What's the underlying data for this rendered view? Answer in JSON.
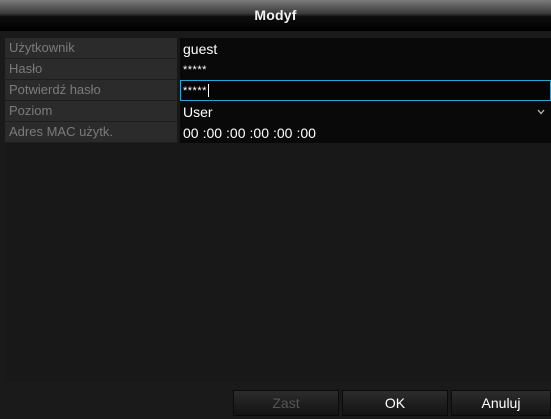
{
  "dialog": {
    "title": "Modyf"
  },
  "fields": {
    "username": {
      "label": "Użytkownik",
      "value": "guest"
    },
    "password": {
      "label": "Hasło",
      "value": "*****"
    },
    "confirm_password": {
      "label": "Potwierdź hasło",
      "value": "*****"
    },
    "level": {
      "label": "Poziom",
      "value": "User",
      "icon": "chevron-down-icon"
    },
    "mac": {
      "label": "Adres MAC użytk.",
      "segments": [
        "00",
        ":00",
        ":00",
        ":00",
        ":00",
        ":00"
      ]
    }
  },
  "buttons": {
    "apply_label": "Zast",
    "ok_label": "OK",
    "cancel_label": "Anuluj"
  },
  "colors": {
    "focus_border": "#28a6d8",
    "label_text": "#7b7b7b",
    "disabled_text": "#555555"
  }
}
